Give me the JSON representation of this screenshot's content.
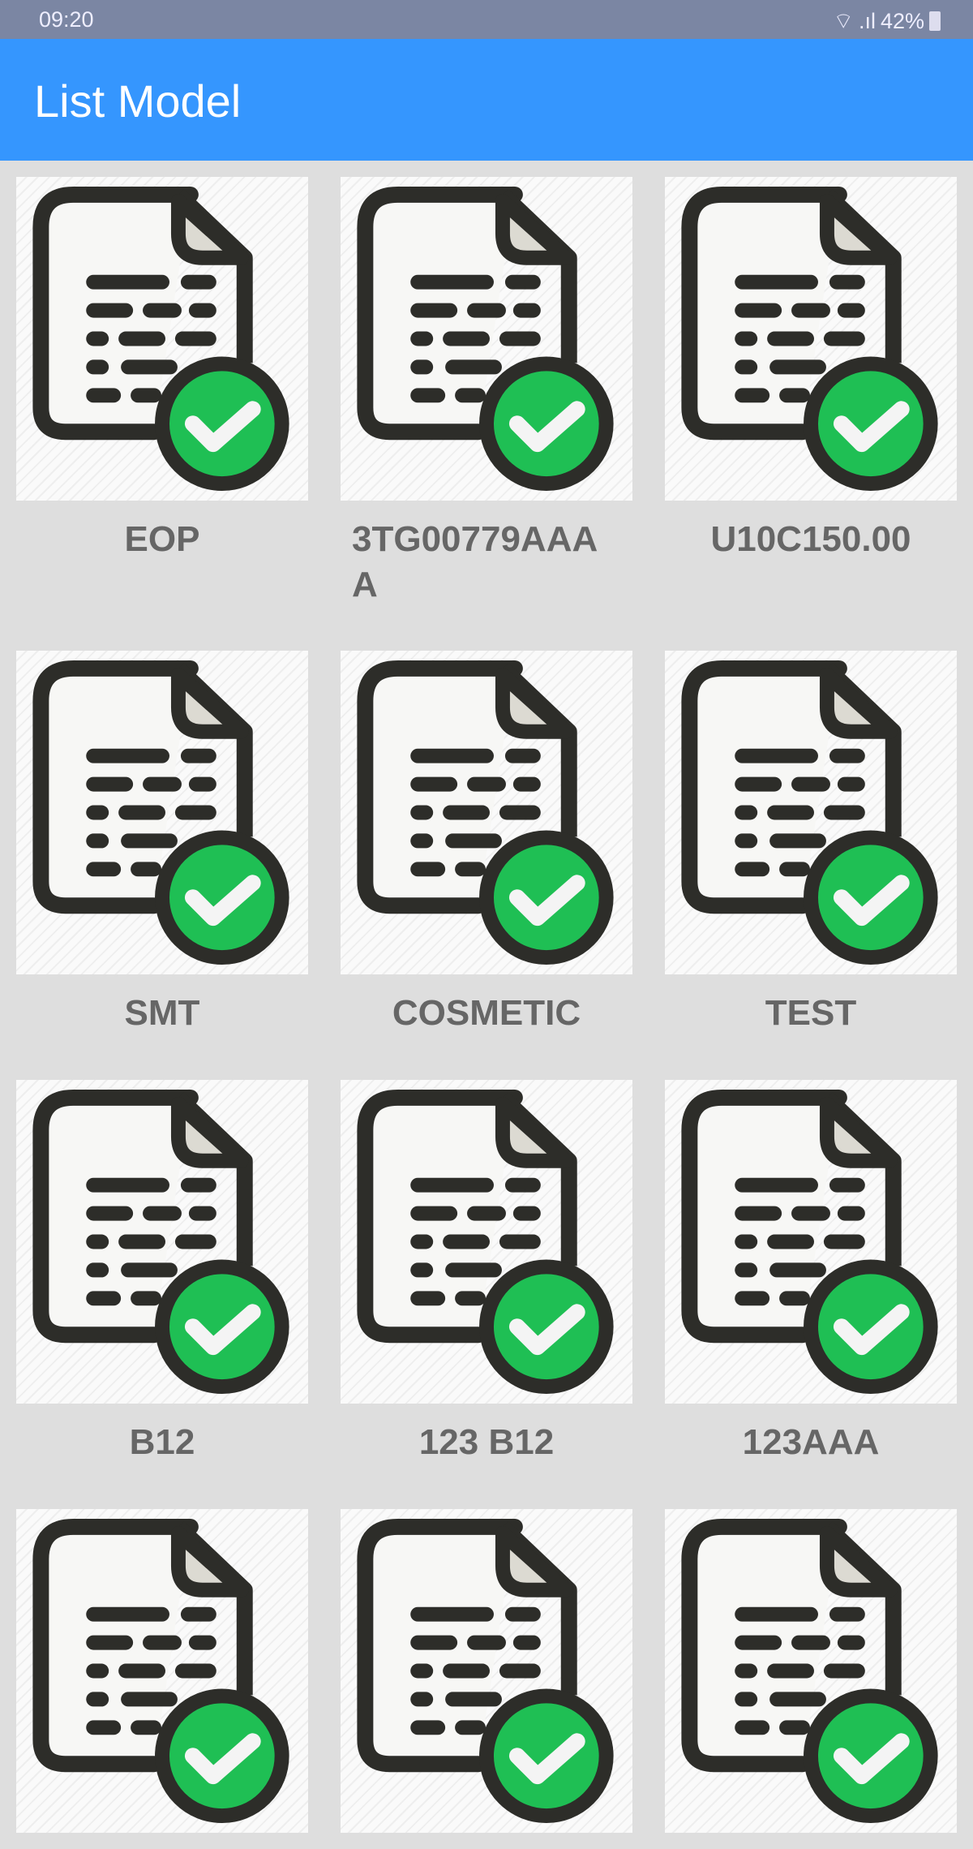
{
  "status_bar": {
    "time": "09:20",
    "battery": "42%"
  },
  "app_bar": {
    "title": "List Model"
  },
  "items": [
    {
      "label": "EOP"
    },
    {
      "label": "3TG00779AAAA"
    },
    {
      "label": "U10C150.00"
    },
    {
      "label": "SMT"
    },
    {
      "label": "COSMETIC"
    },
    {
      "label": "TEST"
    },
    {
      "label": "B12"
    },
    {
      "label": "123 B12"
    },
    {
      "label": "123AAA"
    },
    {
      "label": ""
    },
    {
      "label": ""
    },
    {
      "label": ""
    }
  ],
  "colors": {
    "app_bar": "#3596fe",
    "status_bar": "#7b86a3",
    "check": "#1fbf54"
  }
}
